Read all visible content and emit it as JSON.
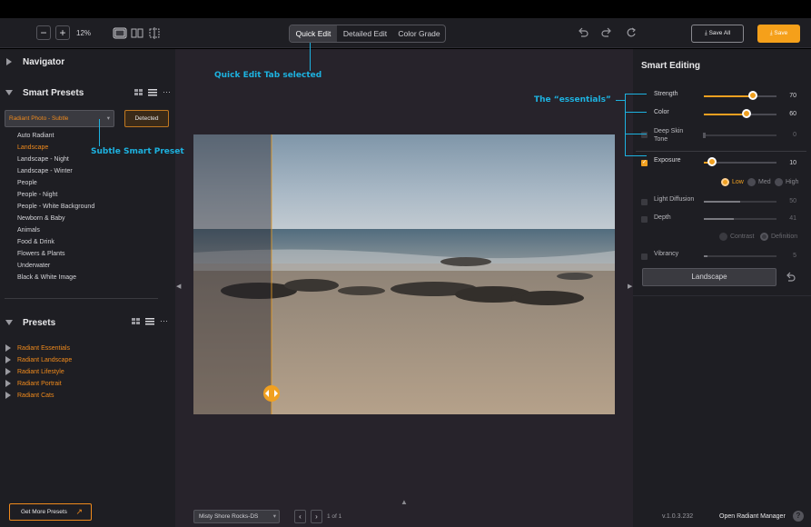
{
  "toolbar": {
    "zoom_out": "−",
    "zoom_in": "+",
    "zoom_level": "12%",
    "tabs": [
      {
        "label": "Quick Edit",
        "active": true
      },
      {
        "label": "Detailed Edit",
        "active": false
      },
      {
        "label": "Color Grade",
        "active": false
      }
    ],
    "save_all": "Save All",
    "save": "Save"
  },
  "left": {
    "navigator": "Navigator",
    "smart_presets": {
      "title": "Smart Presets",
      "dropdown_value": "Radiant Photo - Subtle",
      "detected": "Detected",
      "items": [
        "Auto Radiant",
        "Landscape",
        "Landscape - Night",
        "Landscape - Winter",
        "People",
        "People - Night",
        "People - White Background",
        "Newborn & Baby",
        "Animals",
        "Food & Drink",
        "Flowers & Plants",
        "Underwater",
        "Black & White Image"
      ],
      "selected": "Landscape"
    },
    "presets": {
      "title": "Presets",
      "items": [
        "Radiant Essentials",
        "Radiant Landscape",
        "Radiant Lifestyle",
        "Radiant Portrait",
        "Radiant Cats"
      ]
    },
    "get_more": "Get More Presets"
  },
  "center": {
    "filename": "Misty Shore Rocks-DS",
    "page": "1 of 1",
    "split_position": 0.19
  },
  "right": {
    "title": "Smart Editing",
    "sliders": [
      {
        "label": "Strength",
        "value": "70",
        "level": 0.7,
        "active": true,
        "checkbox": false
      },
      {
        "label": "Color",
        "value": "60",
        "level": 0.6,
        "active": true,
        "checkbox": false
      },
      {
        "label": "Deep Skin Tone",
        "value": "0",
        "level": 0.0,
        "active": false,
        "checkbox": true
      },
      {
        "label": "Exposure",
        "value": "10",
        "level": 0.1,
        "active": true,
        "checkbox": true
      },
      {
        "label": "Light Diffusion",
        "value": "50",
        "level": 0.5,
        "active": false,
        "checkbox": true
      },
      {
        "label": "Depth",
        "value": "41",
        "level": 0.41,
        "active": false,
        "checkbox": true
      },
      {
        "label": "Vibrancy",
        "value": "5",
        "level": 0.05,
        "active": false,
        "checkbox": true
      }
    ],
    "exposure_options": [
      "Low",
      "Med",
      "High"
    ],
    "depth_options": [
      "Contrast",
      "Definition"
    ],
    "scene_button": "Landscape",
    "version": "v.1.0.3.232",
    "open_manager": "Open Radiant Manager"
  },
  "annotations": {
    "quick_edit": "Quick Edit Tab selected",
    "essentials": "The “essentials”",
    "subtle": "Subtle Smart Preset"
  },
  "colors": {
    "accent": "#f0a020",
    "annotation": "#1db2e0",
    "preset_orange": "#f08a1c"
  }
}
